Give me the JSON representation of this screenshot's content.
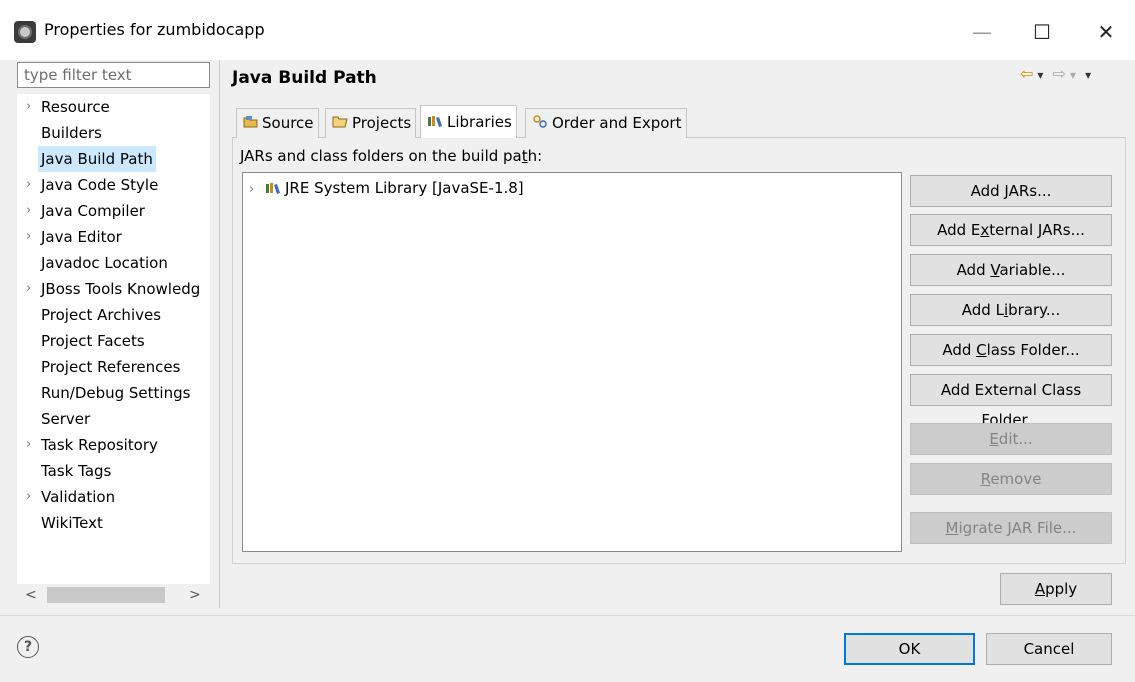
{
  "window": {
    "title": "Properties for zumbidocapp",
    "minimize_glyph": "—",
    "maximize_glyph": "☐",
    "close_glyph": "✕"
  },
  "filter": {
    "placeholder": "type filter text",
    "value": ""
  },
  "nav": {
    "items": [
      {
        "label": "Resource",
        "expandable": true
      },
      {
        "label": "Builders",
        "expandable": false
      },
      {
        "label": "Java Build Path",
        "expandable": false,
        "selected": true
      },
      {
        "label": "Java Code Style",
        "expandable": true
      },
      {
        "label": "Java Compiler",
        "expandable": true
      },
      {
        "label": "Java Editor",
        "expandable": true
      },
      {
        "label": "Javadoc Location",
        "expandable": false
      },
      {
        "label": "JBoss Tools Knowledg",
        "expandable": true
      },
      {
        "label": "Project Archives",
        "expandable": false
      },
      {
        "label": "Project Facets",
        "expandable": false
      },
      {
        "label": "Project References",
        "expandable": false
      },
      {
        "label": "Run/Debug Settings",
        "expandable": false
      },
      {
        "label": "Server",
        "expandable": false
      },
      {
        "label": "Task Repository",
        "expandable": true
      },
      {
        "label": "Task Tags",
        "expandable": false
      },
      {
        "label": "Validation",
        "expandable": true
      },
      {
        "label": "WikiText",
        "expandable": false
      }
    ],
    "scroll_left": "<",
    "scroll_right": ">"
  },
  "page": {
    "title": "Java Build Path"
  },
  "tabs": [
    {
      "label": "Source",
      "icon": "source-folder-icon"
    },
    {
      "label": "Projects",
      "icon": "projects-folder-icon"
    },
    {
      "label": "Libraries",
      "icon": "libraries-icon",
      "active": true
    },
    {
      "label": "Order and Export",
      "icon": "order-export-icon"
    }
  ],
  "libraries": {
    "heading_pre": "JARs and class folders on the build pa",
    "heading_mn": "t",
    "heading_post": "h:",
    "tree": [
      {
        "label": "JRE System Library [JavaSE-1.8]"
      }
    ]
  },
  "buttons": [
    {
      "pre": "Add ",
      "mn": "J",
      "post": "ARs...",
      "disabled": false
    },
    {
      "pre": "Add E",
      "mn": "x",
      "post": "ternal JARs...",
      "disabled": false
    },
    {
      "pre": "Add ",
      "mn": "V",
      "post": "ariable...",
      "disabled": false
    },
    {
      "pre": "Add L",
      "mn": "i",
      "post": "brary...",
      "disabled": false
    },
    {
      "pre": "Add ",
      "mn": "C",
      "post": "lass Folder...",
      "disabled": false
    },
    {
      "pre": "Add External Class Fol",
      "mn": "d",
      "post": "er...",
      "disabled": false
    },
    {
      "pre": "",
      "mn": "E",
      "post": "dit...",
      "disabled": true
    },
    {
      "pre": "",
      "mn": "R",
      "post": "emove",
      "disabled": true
    },
    {
      "pre": "",
      "mn": "M",
      "post": "igrate JAR File...",
      "disabled": true
    }
  ],
  "apply": {
    "pre": "",
    "mn": "A",
    "post": "pply"
  },
  "footer": {
    "help_glyph": "?",
    "ok": "OK",
    "cancel": "Cancel"
  },
  "history": {
    "back": "⇦",
    "forward": "⇨",
    "menu": "▾"
  },
  "colors": {
    "selection": "#cce8ff",
    "default_border": "#0078d7",
    "history_arrow": "#c68e00"
  }
}
